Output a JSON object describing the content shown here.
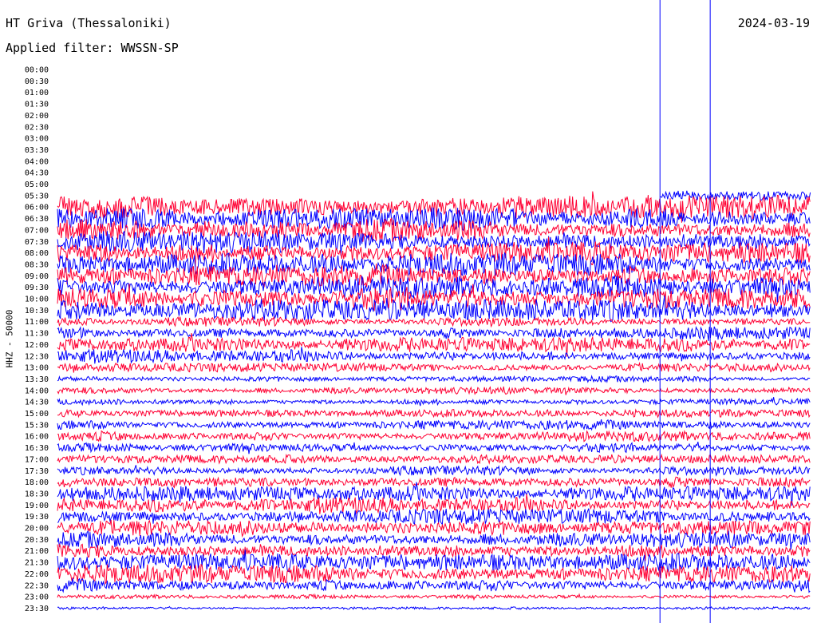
{
  "header": {
    "station": "HT Griva (Thessaloniki)",
    "filter": "Applied filter: WWSSN-SP",
    "date": "2024-03-19"
  },
  "chart_data": {
    "type": "line",
    "title": "HT Griva (Thessaloniki)",
    "subtitle": "Applied filter: WWSSN-SP",
    "date": "2024-03-19",
    "ylabel": "HHZ - 50000",
    "xlabel": "",
    "trace_colors": [
      "#ff0033",
      "#0000ff"
    ],
    "marker_color": "#0000ff",
    "trace_start_minute": 1440,
    "rows": [
      {
        "label": "00:00",
        "amp": 0.0
      },
      {
        "label": "00:30",
        "amp": 0.0
      },
      {
        "label": "01:00",
        "amp": 0.0
      },
      {
        "label": "01:30",
        "amp": 0.0
      },
      {
        "label": "02:00",
        "amp": 0.0
      },
      {
        "label": "02:30",
        "amp": 0.0
      },
      {
        "label": "03:00",
        "amp": 0.0
      },
      {
        "label": "03:30",
        "amp": 0.0
      },
      {
        "label": "04:00",
        "amp": 0.0
      },
      {
        "label": "04:30",
        "amp": 0.0
      },
      {
        "label": "05:00",
        "amp": 0.0
      },
      {
        "label": "05:30",
        "amp": 0.0
      },
      {
        "label": "06:00",
        "amp": 1.35
      },
      {
        "label": "06:30",
        "amp": 1.35
      },
      {
        "label": "07:00",
        "amp": 1.35
      },
      {
        "label": "07:30",
        "amp": 1.35
      },
      {
        "label": "08:00",
        "amp": 1.35
      },
      {
        "label": "08:30",
        "amp": 1.35
      },
      {
        "label": "09:00",
        "amp": 1.35
      },
      {
        "label": "09:30",
        "amp": 1.35
      },
      {
        "label": "10:00",
        "amp": 1.35
      },
      {
        "label": "10:30",
        "amp": 1.3
      },
      {
        "label": "11:00",
        "amp": 0.55
      },
      {
        "label": "11:30",
        "amp": 0.75
      },
      {
        "label": "12:00",
        "amp": 0.85
      },
      {
        "label": "12:30",
        "amp": 0.75
      },
      {
        "label": "13:00",
        "amp": 0.5
      },
      {
        "label": "13:30",
        "amp": 0.35
      },
      {
        "label": "14:00",
        "amp": 0.45
      },
      {
        "label": "14:30",
        "amp": 0.4
      },
      {
        "label": "15:00",
        "amp": 0.45
      },
      {
        "label": "15:30",
        "amp": 0.6
      },
      {
        "label": "16:00",
        "amp": 0.6
      },
      {
        "label": "16:30",
        "amp": 0.55
      },
      {
        "label": "17:00",
        "amp": 0.5
      },
      {
        "label": "17:30",
        "amp": 0.55
      },
      {
        "label": "18:00",
        "amp": 0.75
      },
      {
        "label": "18:30",
        "amp": 0.85
      },
      {
        "label": "19:00",
        "amp": 0.9
      },
      {
        "label": "19:30",
        "amp": 0.9
      },
      {
        "label": "20:00",
        "amp": 0.95
      },
      {
        "label": "20:30",
        "amp": 1.0
      },
      {
        "label": "21:00",
        "amp": 1.0
      },
      {
        "label": "21:30",
        "amp": 1.05
      },
      {
        "label": "22:00",
        "amp": 1.1
      },
      {
        "label": "22:30",
        "amp": 0.8
      },
      {
        "label": "23:00",
        "amp": 0.25
      },
      {
        "label": "23:30",
        "amp": 0.15
      }
    ],
    "partial_start": {
      "row": "05:30",
      "minute": 24.0,
      "amp": 0.55
    },
    "event_markers_minute": [
      24.0,
      26.0
    ]
  }
}
